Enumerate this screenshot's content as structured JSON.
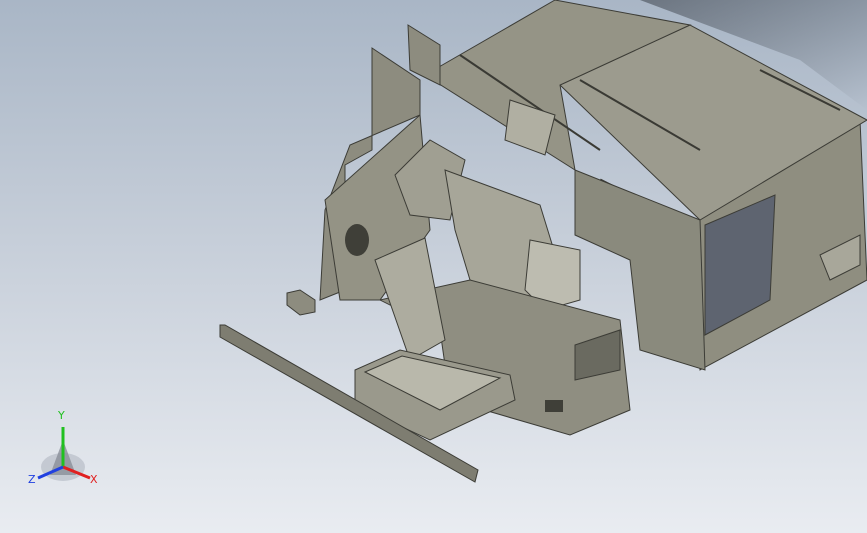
{
  "viewport": {
    "background_top": "#a9b6c6",
    "background_bottom": "#e9ecf1",
    "model_color": "#8d8c7e"
  },
  "triad": {
    "x_label": "X",
    "y_label": "Y",
    "z_label": "Z",
    "x_color": "#e02020",
    "y_color": "#20c020",
    "z_color": "#2040e0"
  }
}
